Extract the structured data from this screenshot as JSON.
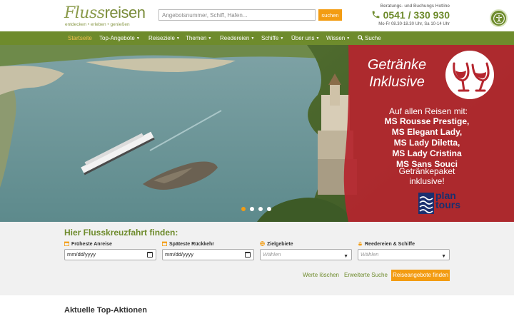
{
  "header": {
    "logo_script": "Fluss",
    "logo_bold": "reisen",
    "logo_tagline": "entdecken • erleben • genießen",
    "search_placeholder": "Angebotsnummer, Schiff, Hafen...",
    "search_button": "suchen",
    "hotline_label": "Beratungs- und Buchungs Hotline",
    "hotline_phone": "0541 / 330 930",
    "hotline_hours": "Mo-Fr 08.30-18.30 Uhr, Sa 10-14 Uhr",
    "accessibility_icon": "accessibility-icon"
  },
  "nav": {
    "items": [
      {
        "label": "Startseite",
        "active": true,
        "dropdown": false
      },
      {
        "label": "Top-Angebote",
        "dropdown": true
      },
      {
        "label": "Reiseziele",
        "dropdown": true
      },
      {
        "label": "Themen",
        "dropdown": true
      },
      {
        "label": "Reedereien",
        "dropdown": true
      },
      {
        "label": "Schiffe",
        "dropdown": true
      },
      {
        "label": "Über uns",
        "dropdown": true
      },
      {
        "label": "Wissen",
        "dropdown": true
      },
      {
        "label": "Suche",
        "dropdown": false,
        "icon": "search-icon"
      }
    ]
  },
  "hero": {
    "promo_title_line1": "Getränke",
    "promo_title_line2": "Inklusive",
    "promo_subtitle": "Auf allen Reisen mit:",
    "ships": [
      "MS Rousse Prestige,",
      "MS Elegant Lady,",
      "MS Lady Diletta,",
      "MS Lady Cristina",
      "MS Sans Souci"
    ],
    "package_line1": "Getränkepaket",
    "package_line2": "inklusive!",
    "brand_line1": "plan",
    "brand_line2": "tours",
    "slides_total": 4,
    "slide_active": 1
  },
  "search_panel": {
    "title": "Hier Flusskreuzfahrt finden:",
    "fields": [
      {
        "label": "Früheste Anreise",
        "value": "mm/dd/yyyy",
        "icon": "calendar-icon"
      },
      {
        "label": "Späteste Rückkehr",
        "value": "mm/dd/yyyy",
        "icon": "calendar-icon"
      },
      {
        "label": "Zielgebiete",
        "placeholder": "Wählen",
        "icon": "globe-icon"
      },
      {
        "label": "Reedereien & Schiffe",
        "placeholder": "Wählen",
        "icon": "ship-icon"
      }
    ],
    "clear_link": "Werte löschen",
    "advanced_link": "Erweiterte Suche",
    "submit_button": "Reiseangebote finden"
  },
  "section": {
    "title": "Aktuelle Top-Aktionen"
  },
  "colors": {
    "brand_green": "#6e8b2c",
    "accent_orange": "#f39c12",
    "promo_red": "#b5262e"
  }
}
